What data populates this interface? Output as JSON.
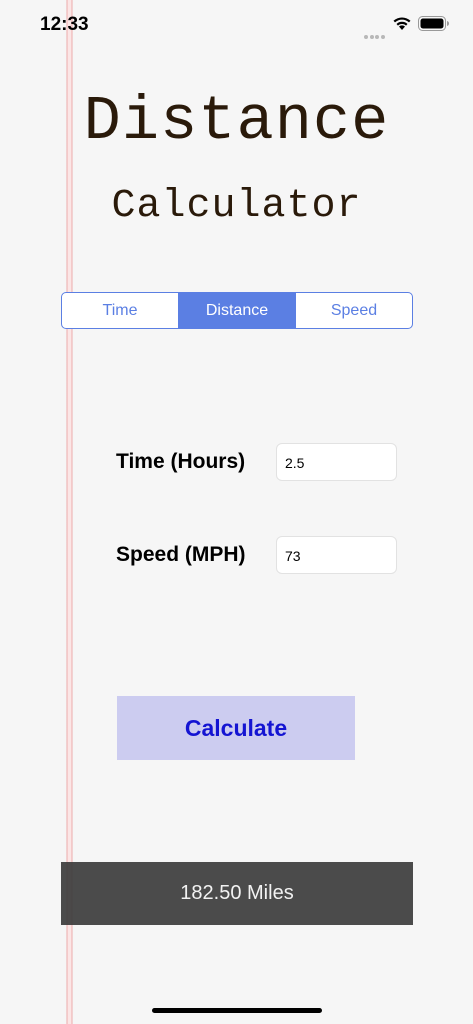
{
  "status_bar": {
    "time": "12:33",
    "icons": [
      "cellular-dots-icon",
      "wifi-icon",
      "battery-icon"
    ]
  },
  "header": {
    "title": "Distance",
    "subtitle": "Calculator"
  },
  "mode_selector": {
    "segments": [
      {
        "label": "Time",
        "selected": false
      },
      {
        "label": "Distance",
        "selected": true
      },
      {
        "label": "Speed",
        "selected": false
      }
    ]
  },
  "form": {
    "time": {
      "label": "Time (Hours)",
      "value": "2.5"
    },
    "speed": {
      "label": "Speed (MPH)",
      "value": "73"
    }
  },
  "calculate_button": {
    "label": "Calculate"
  },
  "result": {
    "text": "182.50 Miles"
  },
  "colors": {
    "accent": "#5b7fe3",
    "button_text": "#1414d2",
    "button_bg": "#aaaaeb",
    "title_text": "#2a1a0a",
    "result_bg": "#3c3c3c"
  }
}
